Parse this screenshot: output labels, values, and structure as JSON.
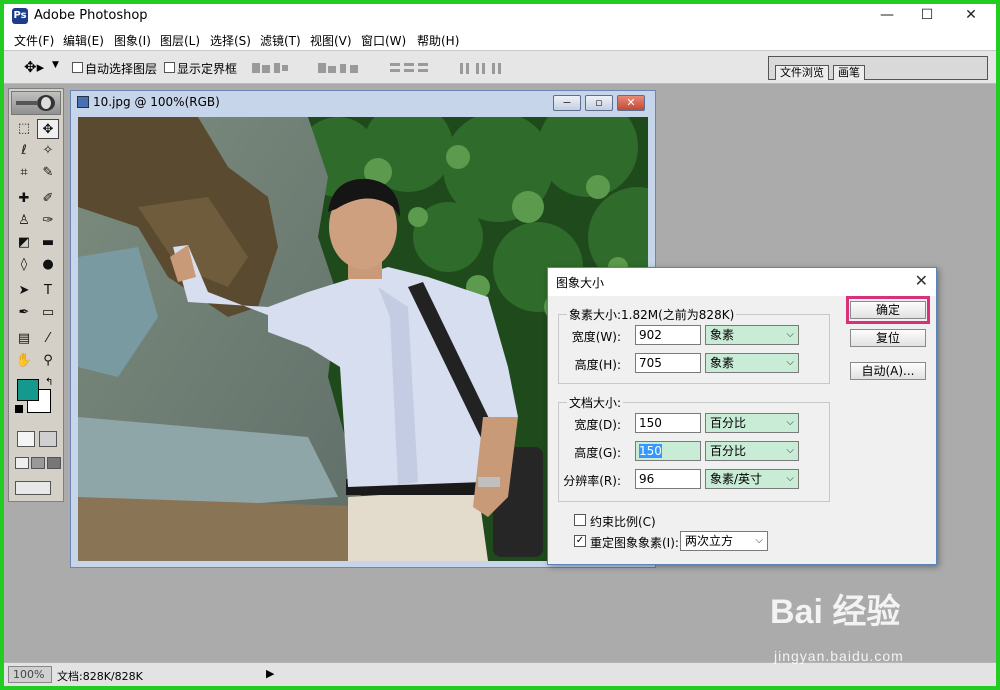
{
  "app": {
    "title": "Adobe Photoshop",
    "icon": "photoshop-app-icon"
  },
  "window_controls": {
    "minimize": "—",
    "maximize": "☐",
    "close": "✕"
  },
  "menu": [
    "文件(F)",
    "编辑(E)",
    "图象(I)",
    "图层(L)",
    "选择(S)",
    "滤镜(T)",
    "视图(V)",
    "窗口(W)",
    "帮助(H)"
  ],
  "options": {
    "auto_select_label": "自动选择图层",
    "show_bounds_label": "显示定界框",
    "tool_icon": "move-tool-icon"
  },
  "palette_well": {
    "tabs": [
      "文件浏览",
      "画笔"
    ]
  },
  "document": {
    "title": "10.jpg @ 100%(RGB)",
    "buttons": {
      "minimize": "−",
      "restore": "▫",
      "close": "✕"
    }
  },
  "dialog": {
    "title": "图象大小",
    "pixel_group": {
      "title": "象素大小:1.82M(之前为828K)",
      "width_label": "宽度(W):",
      "width_value": "902",
      "width_unit": "象素",
      "height_label": "高度(H):",
      "height_value": "705",
      "height_unit": "象素"
    },
    "doc_group": {
      "title": "文档大小:",
      "width_label": "宽度(D):",
      "width_value": "150",
      "width_unit": "百分比",
      "height_label": "高度(G):",
      "height_value": "150",
      "height_unit": "百分比",
      "res_label": "分辨率(R):",
      "res_value": "96",
      "res_unit": "象素/英寸"
    },
    "constrain_label": "约束比例(C)",
    "constrain_checked": false,
    "resample_label": "重定图象象素(I):",
    "resample_checked": true,
    "resample_method": "两次立方",
    "buttons": {
      "ok": "确定",
      "reset": "复位",
      "auto": "自动(A)..."
    },
    "highlight_color": "#d8307a"
  },
  "toolbox": {
    "fg_color": "#15998f",
    "bg_color": "#ffffff"
  },
  "status": {
    "zoom": "100%",
    "doc_size": "文档:828K/828K",
    "arrow": "▶"
  },
  "watermark": {
    "brand": "Bai 经验",
    "url": "jingyan.baidu.com"
  }
}
